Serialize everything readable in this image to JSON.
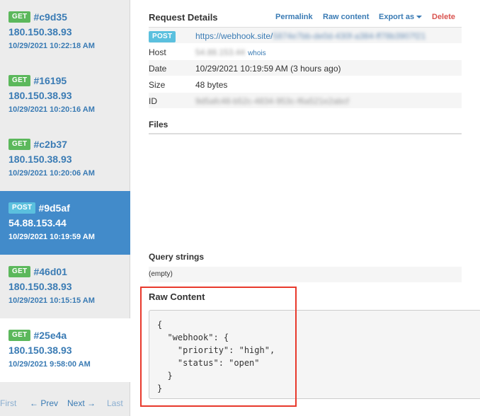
{
  "sidebar": {
    "requests": [
      {
        "method": "GET",
        "id": "#c9d35",
        "ip": "180.150.38.93",
        "time": "10/29/2021 10:22:18 AM"
      },
      {
        "method": "GET",
        "id": "#16195",
        "ip": "180.150.38.93",
        "time": "10/29/2021 10:20:16 AM"
      },
      {
        "method": "GET",
        "id": "#c2b37",
        "ip": "180.150.38.93",
        "time": "10/29/2021 10:20:06 AM"
      },
      {
        "method": "POST",
        "id": "#9d5af",
        "ip": "54.88.153.44",
        "time": "10/29/2021 10:19:59 AM"
      },
      {
        "method": "GET",
        "id": "#46d01",
        "ip": "180.150.38.93",
        "time": "10/29/2021 10:15:15 AM"
      },
      {
        "method": "GET",
        "id": "#25e4a",
        "ip": "180.150.38.93",
        "time": "10/29/2021 9:58:00 AM"
      }
    ],
    "pager": {
      "first": "First",
      "prev": "← Prev",
      "next": "Next →",
      "last": "Last"
    }
  },
  "details": {
    "title": "Request Details",
    "actions": {
      "permalink": "Permalink",
      "raw": "Raw content",
      "export": "Export as",
      "delete": "Delete"
    },
    "method": "POST",
    "url_prefix": "https://webhook.site/",
    "url_blurred": "5874e7bb-de0d-430f-a384-ff78b3907f21",
    "host_label": "Host",
    "host_value": "54.88.153.44",
    "whois": "whois",
    "date_label": "Date",
    "date_value": "10/29/2021 10:19:59 AM (3 hours ago)",
    "size_label": "Size",
    "size_value": "48 bytes",
    "id_label": "ID",
    "id_value": "9d5afc48-b52c-4834-953c-f6a521e2abcf"
  },
  "files": {
    "title": "Files"
  },
  "query": {
    "title": "Query strings",
    "value": "(empty)"
  },
  "raw_content": {
    "title": "Raw Content",
    "body": "{\n  \"webhook\": {\n    \"priority\": \"high\",\n    \"status\": \"open\"\n  }\n}"
  },
  "colors": {
    "accent": "#428bca",
    "get": "#5cb85c",
    "post": "#5bc0de",
    "delete": "#d9534f",
    "highlight": "#e8392c"
  }
}
